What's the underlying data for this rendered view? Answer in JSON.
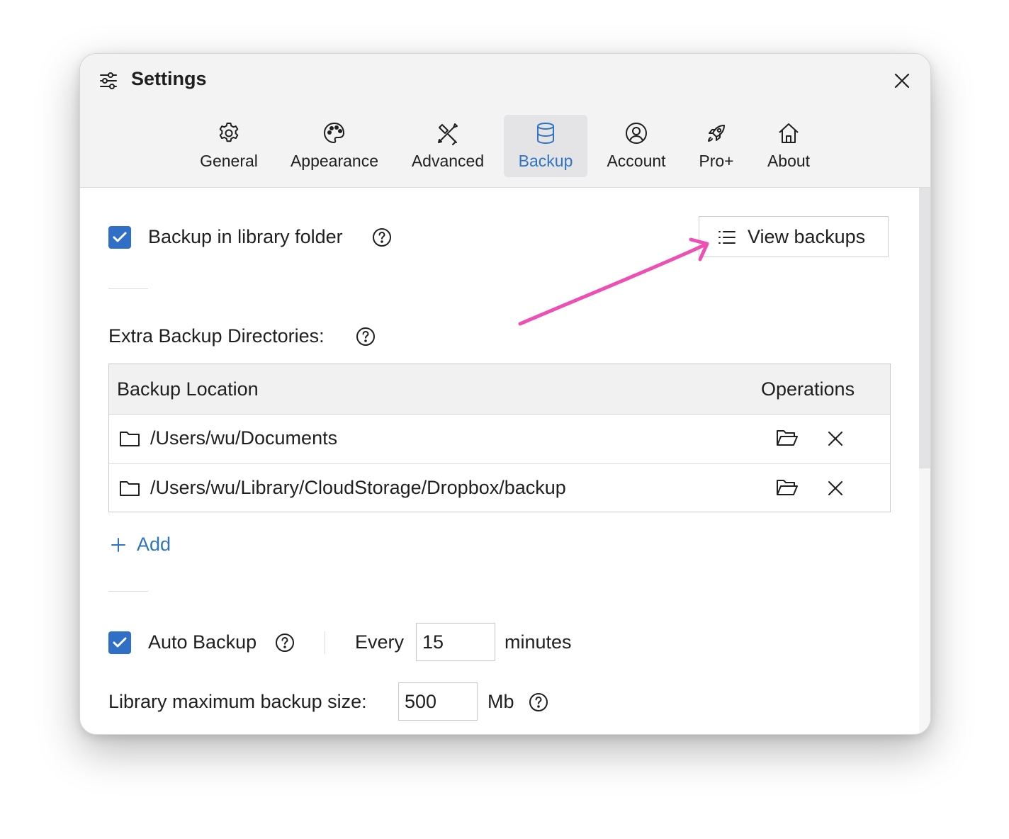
{
  "window": {
    "title": "Settings",
    "title_icon": "sliders-icon",
    "close_icon": "close-icon"
  },
  "tabs": [
    {
      "label": "General",
      "icon": "gear-icon",
      "active": false
    },
    {
      "label": "Appearance",
      "icon": "palette-icon",
      "active": false
    },
    {
      "label": "Advanced",
      "icon": "tools-icon",
      "active": false
    },
    {
      "label": "Backup",
      "icon": "database-icon",
      "active": true
    },
    {
      "label": "Account",
      "icon": "user-circle-icon",
      "active": false
    },
    {
      "label": "Pro+",
      "icon": "rocket-icon",
      "active": false
    },
    {
      "label": "About",
      "icon": "home-icon",
      "active": false
    }
  ],
  "backup_library": {
    "checked": true,
    "label": "Backup in library folder",
    "help_icon": "help-icon"
  },
  "view_backups": {
    "label": "View backups",
    "icon": "list-icon"
  },
  "extra_dirs": {
    "label": "Extra Backup Directories:",
    "columns": [
      "Backup Location",
      "Operations"
    ],
    "rows": [
      {
        "path": "/Users/wu/Documents"
      },
      {
        "path": "/Users/wu/Library/CloudStorage/Dropbox/backup"
      }
    ],
    "row_icons": {
      "location": "folder-icon",
      "open": "folder-open-icon",
      "remove": "close-icon"
    }
  },
  "add_link": {
    "label": "Add"
  },
  "auto_backup": {
    "checked": true,
    "label": "Auto Backup",
    "every_label": "Every",
    "interval_value": "15",
    "unit_label": "minutes"
  },
  "max_size": {
    "label": "Library maximum backup size:",
    "value": "500",
    "unit_label": "Mb"
  },
  "colors": {
    "accent": "#2f74c0",
    "checkbox": "#2f6fc6",
    "annotation_arrow": "#ee4fb5",
    "titlebar_bg": "#f3f3f4"
  }
}
